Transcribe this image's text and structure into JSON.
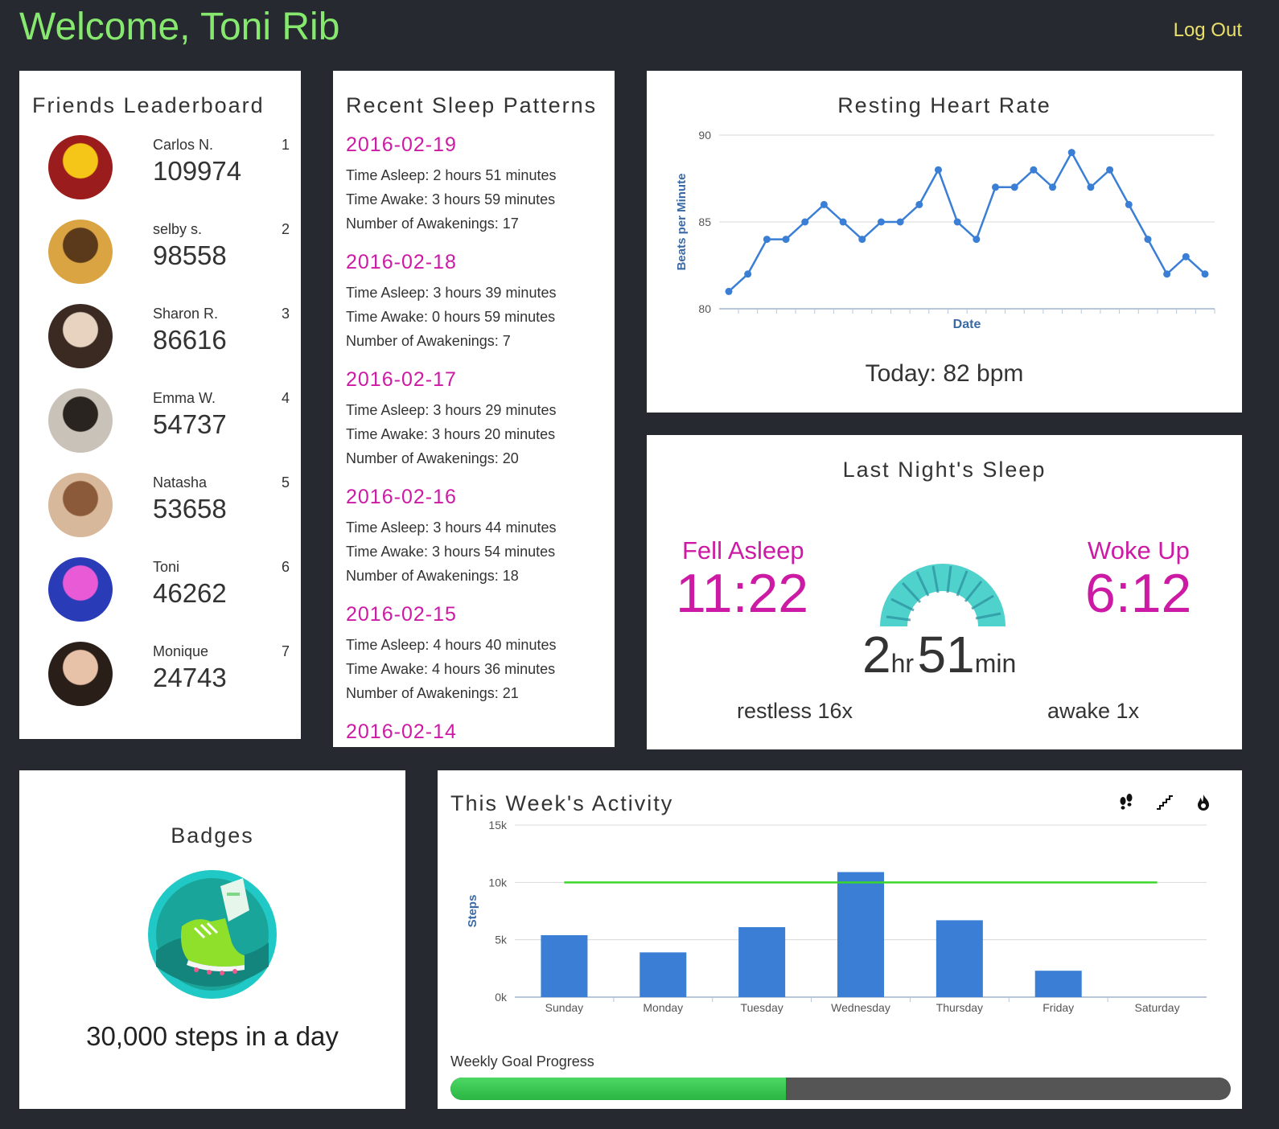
{
  "header": {
    "welcome": "Welcome, Toni Rib",
    "logout": "Log Out"
  },
  "leaderboard": {
    "title": "Friends Leaderboard",
    "entries": [
      {
        "name": "Carlos N.",
        "rank": "1",
        "score": "109974"
      },
      {
        "name": "selby s.",
        "rank": "2",
        "score": "98558"
      },
      {
        "name": "Sharon R.",
        "rank": "3",
        "score": "86616"
      },
      {
        "name": "Emma W.",
        "rank": "4",
        "score": "54737"
      },
      {
        "name": "Natasha",
        "rank": "5",
        "score": "53658"
      },
      {
        "name": "Toni",
        "rank": "6",
        "score": "46262"
      },
      {
        "name": "Monique",
        "rank": "7",
        "score": "24743"
      }
    ]
  },
  "sleep_patterns": {
    "title": "Recent Sleep Patterns",
    "entries": [
      {
        "date": "2016-02-19",
        "asleep": "Time Asleep: 2 hours 51 minutes",
        "awake": "Time Awake: 3 hours 59 minutes",
        "awakenings": "Number of Awakenings: 17"
      },
      {
        "date": "2016-02-18",
        "asleep": "Time Asleep: 3 hours 39 minutes",
        "awake": "Time Awake: 0 hours 59 minutes",
        "awakenings": "Number of Awakenings: 7"
      },
      {
        "date": "2016-02-17",
        "asleep": "Time Asleep: 3 hours 29 minutes",
        "awake": "Time Awake: 3 hours 20 minutes",
        "awakenings": "Number of Awakenings: 20"
      },
      {
        "date": "2016-02-16",
        "asleep": "Time Asleep: 3 hours 44 minutes",
        "awake": "Time Awake: 3 hours 54 minutes",
        "awakenings": "Number of Awakenings: 18"
      },
      {
        "date": "2016-02-15",
        "asleep": "Time Asleep: 4 hours 40 minutes",
        "awake": "Time Awake: 4 hours 36 minutes",
        "awakenings": "Number of Awakenings: 21"
      },
      {
        "date": "2016-02-14",
        "asleep": "",
        "awake": "",
        "awakenings": ""
      }
    ]
  },
  "heart_rate": {
    "title": "Resting Heart Rate",
    "today": "Today: 82 bpm",
    "line_color": "#3a7fd5"
  },
  "last_night": {
    "title": "Last Night's Sleep",
    "fell_asleep_label": "Fell Asleep",
    "fell_asleep_time": "11:22",
    "woke_up_label": "Woke Up",
    "woke_up_time": "6:12",
    "hours": "2",
    "hours_unit": "hr",
    "minutes": "51",
    "minutes_unit": "min",
    "restless": "restless 16x",
    "awake": "awake 1x",
    "accent_color": "#cc1aa5",
    "gauge_color": "#4fd1cc"
  },
  "badges": {
    "title": "Badges",
    "badge_text": "30,000 steps in a day",
    "badge_icon": "sneaker-badge-icon"
  },
  "activity": {
    "title": "This Week's Activity",
    "icons": [
      "footsteps-icon",
      "stairs-icon",
      "flame-icon"
    ],
    "weekly_goal_label": "Weekly Goal Progress",
    "weekly_goal_progress": 0.43,
    "bar_color": "#3a7fd5",
    "goal_line_color": "#3ad62a"
  },
  "chart_data": [
    {
      "type": "line",
      "title": "Resting Heart Rate",
      "xlabel": "Date",
      "ylabel": "Beats per Minute",
      "ylim": [
        80,
        90
      ],
      "yticks": [
        "80",
        "85",
        "90"
      ],
      "series": [
        {
          "values": [
            81,
            82,
            84,
            84,
            85,
            86,
            85,
            84,
            85,
            85,
            86,
            88,
            85,
            84,
            87,
            87,
            88,
            87,
            89,
            87,
            88,
            86,
            84,
            82,
            83,
            82
          ]
        }
      ],
      "grid": true
    },
    {
      "type": "bar",
      "ylabel": "Steps",
      "ylim": [
        0,
        15000
      ],
      "yticks": [
        "0k",
        "5k",
        "10k",
        "15k"
      ],
      "categories": [
        "Sunday",
        "Monday",
        "Tuesday",
        "Wednesday",
        "Thursday",
        "Friday",
        "Saturday"
      ],
      "values": [
        5400,
        3900,
        6100,
        10900,
        6700,
        2300,
        0
      ],
      "goal": 10000,
      "grid": true
    }
  ]
}
